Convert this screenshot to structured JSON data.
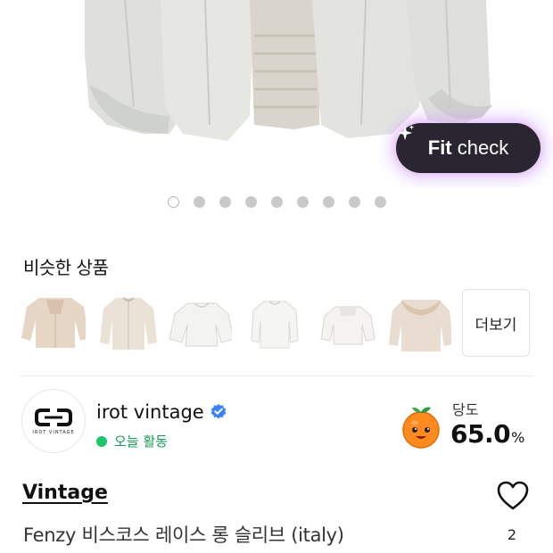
{
  "hero": {
    "fit_check": {
      "bold": "Fit",
      "rest": " check",
      "icon": "sparkle-icon"
    },
    "image_count": 9,
    "active_index": 0
  },
  "similar": {
    "title": "비슷한 상품",
    "items": [
      {
        "name": "beige-embroidered-blouse"
      },
      {
        "name": "beige-long-sleeve-blouse"
      },
      {
        "name": "white-puff-blouse"
      },
      {
        "name": "white-blouse"
      },
      {
        "name": "white-lace-blouse"
      },
      {
        "name": "beige-ruffle-collar-blouse"
      }
    ],
    "more_label": "더보기"
  },
  "seller": {
    "name": "irot vintage",
    "verified": true,
    "status": "오늘 활동",
    "logo_text": "IROT VINTAGE",
    "sweetness_label": "당도",
    "sweetness_value": "65.0",
    "sweetness_unit": "%"
  },
  "product": {
    "category": "Vintage",
    "title": "Fenzy 비스코스 레이스 롱 슬리브 (italy)",
    "like_count": "2"
  },
  "colors": {
    "accent_green": "#1fc46b",
    "fit_check_bg": "#2a2631",
    "verified_blue": "#3b82f6"
  }
}
